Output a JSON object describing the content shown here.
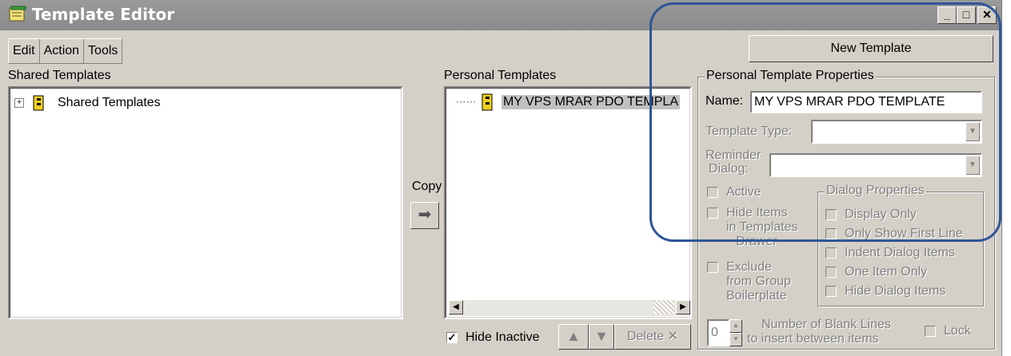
{
  "window": {
    "title": "Template Editor",
    "minimize": "_",
    "maximize": "□",
    "close": "✕"
  },
  "menu": {
    "edit": "Edit",
    "action": "Action",
    "tools": "Tools"
  },
  "shared": {
    "label": "Shared Templates",
    "tree_item": "Shared Templates"
  },
  "copy": {
    "label": "Copy",
    "arrow": "➡"
  },
  "personal": {
    "label": "Personal Templates",
    "item": "MY VPS MRAR PDO TEMPLA",
    "hide_inactive": "Hide Inactive",
    "hide_inactive_checked": "✓",
    "up": "▲",
    "down": "▼",
    "delete": "Delete",
    "delete_x": "✕"
  },
  "new_template": "New Template",
  "properties": {
    "group": "Personal Template Properties",
    "name_label": "Name:",
    "name_value": "MY VPS MRAR PDO TEMPLATE",
    "type_label": "Template Type:",
    "reminder_label_1": "Reminder",
    "reminder_label_2": "Dialog:",
    "active": "Active",
    "hide_items_1": "Hide Items",
    "hide_items_2": "in Templates",
    "hide_items_3": "Drawer",
    "exclude_1": "Exclude",
    "exclude_2": "from Group",
    "exclude_3": "Boilerplate",
    "blank_lines_value": "0",
    "blank_lines_label_1": "Number of Blank Lines",
    "blank_lines_label_2": "to insert between items",
    "lock": "Lock"
  },
  "dialog_props": {
    "group": "Dialog Properties",
    "display_only": "Display Only",
    "only_first": "Only Show First Line",
    "indent": "Indent Dialog Items",
    "one_item": "One Item Only",
    "hide_dialog": "Hide Dialog Items"
  },
  "colors": {
    "annotation": "#2f5597",
    "face": "#d4d0c8",
    "title_bar": "#8a8a8a"
  }
}
